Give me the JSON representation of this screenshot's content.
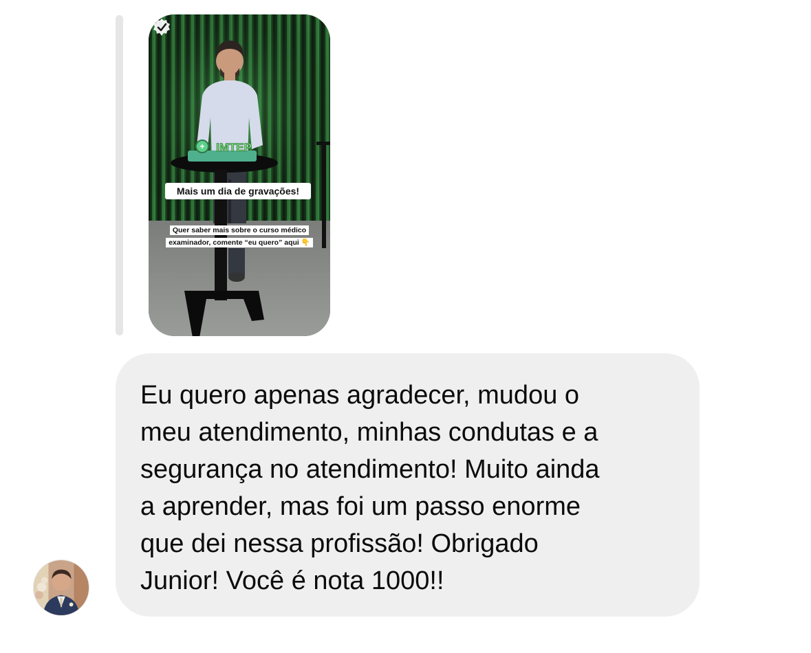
{
  "story_reply": {
    "story": {
      "overlay_title": "Mais um dia de gravações!",
      "overlay_subtitle": "Quer saber mais sobre o curso médico examinador, comente “eu quero” aqui 👇",
      "sign_text": "IMTEP",
      "badge_icon": "check-badge-icon"
    }
  },
  "message": {
    "text": "Eu quero apenas agradecer, mudou o\nmeu atendimento, minhas condutas e a\nsegurança no atendimento! Muito ainda\na aprender, mas foi um passo enorme\nque dei nessa profissão! Obrigado\nJunior! Você é nota 1000!!"
  },
  "sender": {
    "avatar_icon": "avatar-icon"
  },
  "colors": {
    "bubble_background": "#efefef",
    "reply_bar": "#e6e6e6",
    "curtain_green": "#2f7a3a"
  }
}
